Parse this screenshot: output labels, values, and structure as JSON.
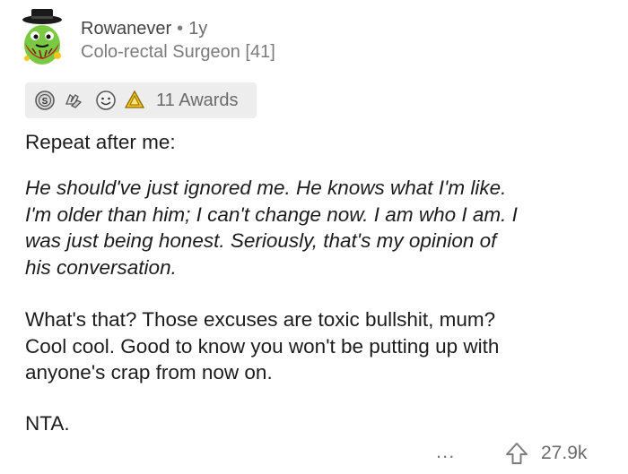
{
  "comment": {
    "username": "Rowanever",
    "separator": "•",
    "age": "1y",
    "flair": "Colo-rectal Surgeon [41]"
  },
  "awards": {
    "label": "11 Awards",
    "icons": [
      "silver-award-icon",
      "hands-award-icon",
      "smile-award-icon",
      "helpful-award-icon"
    ]
  },
  "body": {
    "p1": "Repeat after me:",
    "p2": "He should've just ignored me. He knows what I'm like.\nI'm older than him; I can't change now. I am who I am. I\nwas just being honest. Seriously, that's my opinion of\nhis conversation.",
    "p3": "What's that? Those excuses are toxic bullshit, mum?\nCool cool. Good to know you won't be putting up with\nanyone's crap from now on.",
    "p4": "NTA."
  },
  "footer": {
    "more": "...",
    "score": "27.9k"
  },
  "colors": {
    "text": "#1c1c1c",
    "meta": "#7c7c7c",
    "awards_bg": "#ededed",
    "avatar_green": "#7ac943",
    "avatar_red": "#b3261e"
  }
}
